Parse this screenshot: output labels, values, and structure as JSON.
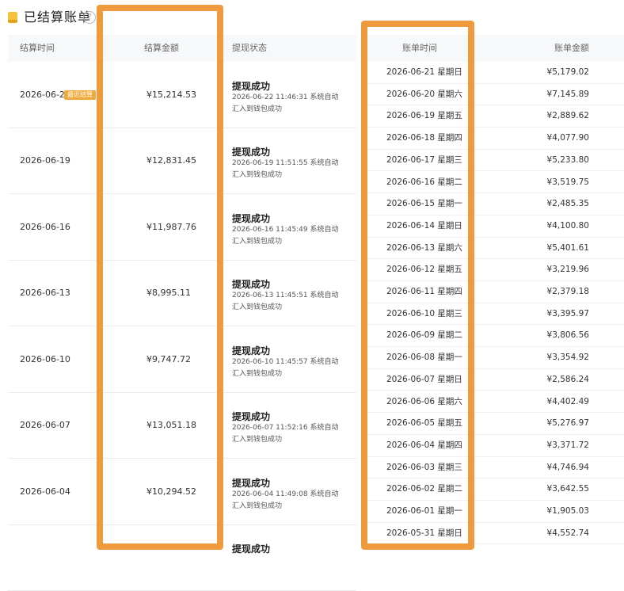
{
  "header": {
    "title": "已结算账单",
    "help_glyph": "?",
    "icon_color": "#f6c23e"
  },
  "settlement_table": {
    "columns": {
      "date": "结算时间",
      "amount": "结算金额",
      "status": "提现状态"
    },
    "badge": "最近结算",
    "rows": [
      {
        "date": "2026-06-22",
        "amount": "¥15,214.53",
        "status_title": "提现成功",
        "status_detail": "2026-06-22 11:46:31 系统自动汇入到钱包成功"
      },
      {
        "date": "2026-06-19",
        "amount": "¥12,831.45",
        "status_title": "提现成功",
        "status_detail": "2026-06-19 11:51:55 系统自动汇入到钱包成功"
      },
      {
        "date": "2026-06-16",
        "amount": "¥11,987.76",
        "status_title": "提现成功",
        "status_detail": "2026-06-16 11:45:49 系统自动汇入到钱包成功"
      },
      {
        "date": "2026-06-13",
        "amount": "¥8,995.11",
        "status_title": "提现成功",
        "status_detail": "2026-06-13 11:45:51 系统自动汇入到钱包成功"
      },
      {
        "date": "2026-06-10",
        "amount": "¥9,747.72",
        "status_title": "提现成功",
        "status_detail": "2026-06-10 11:45:57 系统自动汇入到钱包成功"
      },
      {
        "date": "2026-06-07",
        "amount": "¥13,051.18",
        "status_title": "提现成功",
        "status_detail": "2026-06-07 11:52:16 系统自动汇入到钱包成功"
      },
      {
        "date": "2026-06-04",
        "amount": "¥10,294.52",
        "status_title": "提现成功",
        "status_detail": "2026-06-04 11:49:08 系统自动汇入到钱包成功"
      },
      {
        "date": "",
        "amount": "",
        "status_title": "提现成功",
        "status_detail": ""
      }
    ]
  },
  "bill_table": {
    "columns": {
      "time": "账单时间",
      "amount": "账单金额"
    },
    "rows": [
      {
        "date": "2026-06-21 星期日",
        "amount": "¥5,179.02"
      },
      {
        "date": "2026-06-20 星期六",
        "amount": "¥7,145.89"
      },
      {
        "date": "2026-06-19 星期五",
        "amount": "¥2,889.62"
      },
      {
        "date": "2026-06-18 星期四",
        "amount": "¥4,077.90"
      },
      {
        "date": "2026-06-17 星期三",
        "amount": "¥5,233.80"
      },
      {
        "date": "2026-06-16 星期二",
        "amount": "¥3,519.75"
      },
      {
        "date": "2026-06-15 星期一",
        "amount": "¥2,485.35"
      },
      {
        "date": "2026-06-14 星期日",
        "amount": "¥4,100.80"
      },
      {
        "date": "2026-06-13 星期六",
        "amount": "¥5,401.61"
      },
      {
        "date": "2026-06-12 星期五",
        "amount": "¥3,219.96"
      },
      {
        "date": "2026-06-11 星期四",
        "amount": "¥2,379.18"
      },
      {
        "date": "2026-06-10 星期三",
        "amount": "¥3,395.97"
      },
      {
        "date": "2026-06-09 星期二",
        "amount": "¥3,806.56"
      },
      {
        "date": "2026-06-08 星期一",
        "amount": "¥3,354.92"
      },
      {
        "date": "2026-06-07 星期日",
        "amount": "¥2,586.24"
      },
      {
        "date": "2026-06-06 星期六",
        "amount": "¥4,402.49"
      },
      {
        "date": "2026-06-05 星期五",
        "amount": "¥5,276.97"
      },
      {
        "date": "2026-06-04 星期四",
        "amount": "¥3,371.72"
      },
      {
        "date": "2026-06-03 星期三",
        "amount": "¥4,746.94"
      },
      {
        "date": "2026-06-02 星期二",
        "amount": "¥3,642.55"
      },
      {
        "date": "2026-06-01 星期一",
        "amount": "¥1,905.03"
      },
      {
        "date": "2026-05-31 星期日",
        "amount": "¥4,552.74"
      }
    ]
  },
  "highlight_color": "#ef9a3c"
}
